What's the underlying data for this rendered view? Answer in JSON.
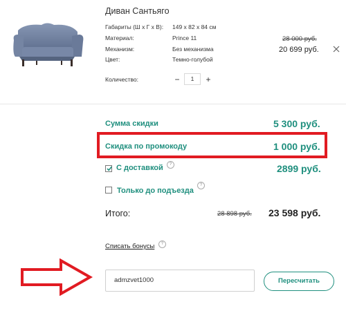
{
  "product": {
    "title": "Диван Сантьяго",
    "specs": [
      {
        "label": "Габариты (Ш х Г х В):",
        "value": "149 х 82 х 84 см"
      },
      {
        "label": "Материал:",
        "value": "Prince 11"
      },
      {
        "label": "Механизм:",
        "value": "Без механизма"
      },
      {
        "label": "Цвет:",
        "value": "Темно-голубой"
      }
    ],
    "old_price": "28 000 руб.",
    "price": "20 699 руб.",
    "quantity_label": "Количество:",
    "quantity": "1",
    "minus": "−",
    "plus": "+"
  },
  "summary": {
    "discount_label": "Сумма скидки",
    "discount_value": "5 300 руб.",
    "promo_discount_label": "Скидка по промокоду",
    "promo_discount_value": "1 000 руб.",
    "delivery_label": "С доставкой",
    "delivery_value": "2899 руб.",
    "delivery_checked": true,
    "pickup_label": "Только до подъезда",
    "pickup_checked": false,
    "help": "?",
    "total_label": "Итого:",
    "total_old": "28 898 руб.",
    "total_value": "23 598 руб."
  },
  "bonus": {
    "link": "Списать бонусы"
  },
  "promo": {
    "code": "admzvet1000",
    "recalc_button": "Пересчитать"
  },
  "colors": {
    "accent": "#1f8f7e",
    "highlight": "#e11b22"
  }
}
